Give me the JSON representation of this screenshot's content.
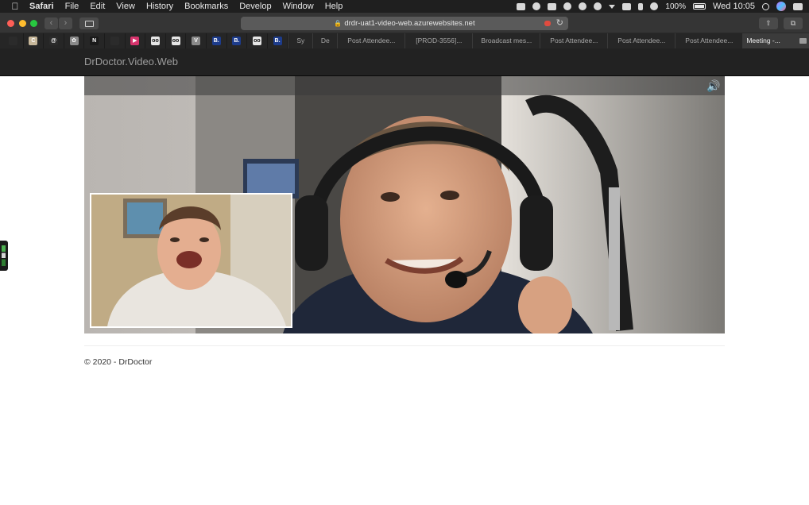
{
  "menubar": {
    "app_name": "Safari",
    "items": [
      "File",
      "Edit",
      "View",
      "History",
      "Bookmarks",
      "Develop",
      "Window",
      "Help"
    ],
    "battery": "100%",
    "clock": "Wed 10:05"
  },
  "toolbar": {
    "url": "drdr-uat1-video-web.azurewebsites.net"
  },
  "tabbar": {
    "pinned": [
      {
        "icon": "pinned-tab-icon",
        "glyph": "",
        "color": "#2b2b2b"
      },
      {
        "icon": "pinned-tab-icon",
        "glyph": "C",
        "color": "#c7b79a"
      },
      {
        "icon": "pinned-tab-icon",
        "glyph": "@",
        "color": "#2b2b2b"
      },
      {
        "icon": "pinned-tab-icon",
        "glyph": "✿",
        "color": "#8a8a8a"
      },
      {
        "icon": "netflix-icon",
        "glyph": "N",
        "color": "#1a1a1a"
      },
      {
        "icon": "pinned-tab-icon",
        "glyph": "",
        "color": "#2b2b2b"
      },
      {
        "icon": "pinned-tab-icon",
        "glyph": "▶",
        "color": "#d6336c"
      },
      {
        "icon": "tripadvisor-icon",
        "glyph": "oo",
        "color": "#e6e6e6"
      },
      {
        "icon": "tripadvisor-icon",
        "glyph": "oo",
        "color": "#e6e6e6"
      },
      {
        "icon": "pinned-tab-icon",
        "glyph": "V",
        "color": "#8a8a8a"
      },
      {
        "icon": "booking-icon",
        "glyph": "B.",
        "color": "#1d3c8c"
      },
      {
        "icon": "booking-icon",
        "glyph": "B.",
        "color": "#1d3c8c"
      },
      {
        "icon": "tripadvisor-icon",
        "glyph": "oo",
        "color": "#e6e6e6"
      },
      {
        "icon": "booking-icon",
        "glyph": "B.",
        "color": "#1d3c8c"
      }
    ],
    "tabs": [
      {
        "label": "Sy",
        "size": "small",
        "active": false
      },
      {
        "label": "De",
        "size": "small",
        "active": false
      },
      {
        "label": "Post Attendee...",
        "size": "wide",
        "active": false
      },
      {
        "label": "[PROD-3556]...",
        "size": "wide",
        "active": false
      },
      {
        "label": "Broadcast mes...",
        "size": "wide",
        "active": false
      },
      {
        "label": "Post Attendee...",
        "size": "wide",
        "active": false
      },
      {
        "label": "Post Attendee...",
        "size": "wide",
        "active": false
      },
      {
        "label": "Post Attendee...",
        "size": "wide",
        "active": false
      },
      {
        "label": "Meeting -...",
        "size": "wide",
        "active": true
      }
    ],
    "new_tab": "+"
  },
  "site": {
    "brand": "DrDoctor.Video.Web",
    "footer": "© 2020 - DrDoctor"
  },
  "colors": {
    "header_bg": "#222222",
    "brand_text": "#9d9d9d",
    "self_view_border": "#ffffff"
  }
}
